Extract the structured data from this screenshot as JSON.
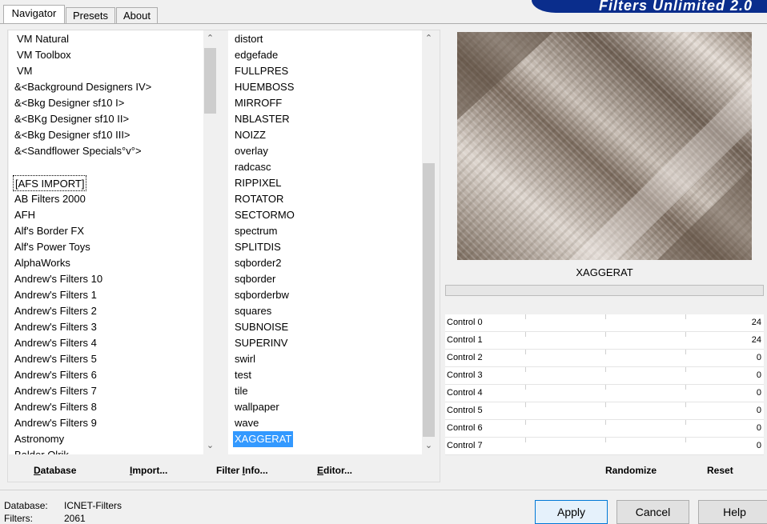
{
  "brand": {
    "title": "Filters Unlimited 2.0"
  },
  "tabs": [
    "Navigator",
    "Presets",
    "About"
  ],
  "categories": [
    "VM Natural",
    "VM Toolbox",
    "VM",
    "&<Background Designers IV>",
    "&<Bkg Designer sf10 I>",
    "&<BKg Designer sf10 II>",
    "&<Bkg Designer sf10 III>",
    "&<Sandflower Specials°v°>",
    "",
    "[AFS IMPORT]",
    "AB Filters 2000",
    "AFH",
    "Alf's Border FX",
    "Alf's Power Toys",
    "AlphaWorks",
    "Andrew's Filters 10",
    "Andrew's Filters 1",
    "Andrew's Filters 2",
    "Andrew's Filters 3",
    "Andrew's Filters 4",
    "Andrew's Filters 5",
    "Andrew's Filters 6",
    "Andrew's Filters 7",
    "Andrew's Filters 8",
    "Andrew's Filters 9",
    "Astronomy",
    "Balder Olrik"
  ],
  "filters": [
    "distort",
    "edgefade",
    "FULLPRES",
    "HUEMBOSS",
    "MIRROFF",
    "NBLASTER",
    "NOIZZ",
    "overlay",
    "radcasc",
    "RIPPIXEL",
    "ROTATOR",
    "SECTORMO",
    "spectrum",
    "SPLITDIS",
    "sqborder2",
    "sqborder",
    "sqborderbw",
    "squares",
    "SUBNOISE",
    "SUPERINV",
    "swirl",
    "test",
    "tile",
    "wallpaper",
    "wave",
    "XAGGERAT"
  ],
  "selected_category": "[AFS IMPORT]",
  "selected_filter": "XAGGERAT",
  "buttons": {
    "database": "Database",
    "database_u": "D",
    "import": "Import...",
    "import_u": "I",
    "filter_info": "Filter Info...",
    "filter_info_u": "I",
    "editor": "Editor...",
    "editor_u": "E",
    "randomize": "Randomize",
    "reset": "Reset",
    "apply": "Apply",
    "cancel": "Cancel",
    "help": "Help"
  },
  "preview_title": "XAGGERAT",
  "controls": [
    {
      "label": "Control 0",
      "value": "24"
    },
    {
      "label": "Control 1",
      "value": "24"
    },
    {
      "label": "Control 2",
      "value": "0"
    },
    {
      "label": "Control 3",
      "value": "0"
    },
    {
      "label": "Control 4",
      "value": "0"
    },
    {
      "label": "Control 5",
      "value": "0"
    },
    {
      "label": "Control 6",
      "value": "0"
    },
    {
      "label": "Control 7",
      "value": "0"
    }
  ],
  "status": {
    "database_label": "Database:",
    "database_value": "ICNET-Filters",
    "filters_label": "Filters:",
    "filters_value": "2061"
  },
  "colors": {
    "selection": "#3399ff",
    "brand": "#0a2d8c",
    "preview_dark": "#6e5f53",
    "preview_light": "#e4dcd5"
  }
}
